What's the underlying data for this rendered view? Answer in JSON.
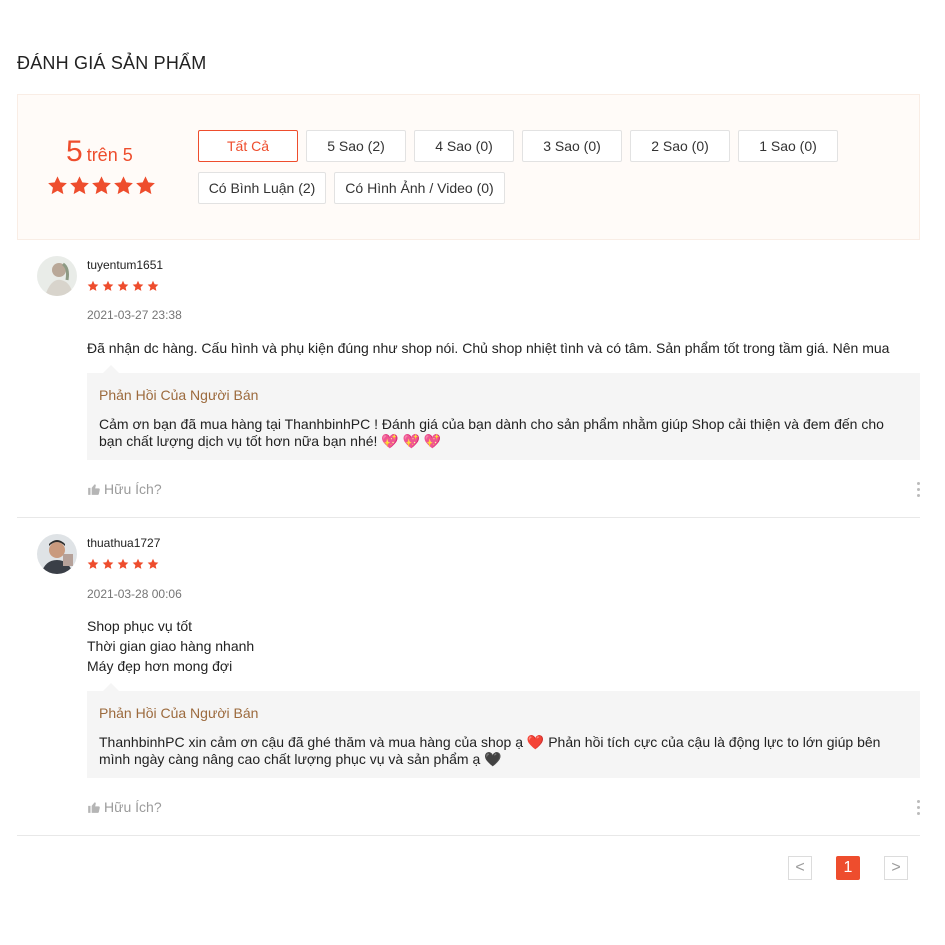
{
  "section_title": "ĐÁNH GIÁ SẢN PHẨM",
  "colors": {
    "accent": "#ee4d2d",
    "reply_title": "#9c6a3d",
    "overview_bg": "#fffbf8"
  },
  "overview": {
    "score": "5",
    "score_suffix": "trên 5",
    "rating_stars": 5,
    "filters_row1": [
      "Tất Cả",
      "5 Sao (2)",
      "4 Sao (0)",
      "3 Sao (0)",
      "2 Sao (0)",
      "1 Sao (0)"
    ],
    "filters_row2": [
      "Có Bình Luận (2)",
      "Có Hình Ảnh / Video (0)"
    ],
    "active_filter": "Tất Cả"
  },
  "reviews": [
    {
      "username": "tuyentum1651",
      "stars": 5,
      "time": "2021-03-27 23:38",
      "content": [
        "Đã nhận dc hàng. Cấu hình và phụ kiện đúng như shop nói. Chủ shop nhiệt tình và có tâm. Sản phẩm tốt trong tầm giá. Nên mua"
      ],
      "reply_title": "Phản Hồi Của Người Bán",
      "reply_text": "Cảm ơn bạn đã mua hàng tại ThanhbinhPC ! Đánh giá của bạn dành cho sản phẩm nhằm giúp Shop cải thiện và đem đến cho bạn chất lượng dịch vụ tốt hơn nữa bạn nhé! 💖 💖 💖",
      "helpful": "Hữu Ích?"
    },
    {
      "username": "thuathua1727",
      "stars": 5,
      "time": "2021-03-28 00:06",
      "content": [
        "Shop phục vụ tốt",
        "Thời gian giao hàng nhanh",
        "Máy đẹp hơn mong đợi"
      ],
      "reply_title": "Phản Hồi Của Người Bán",
      "reply_text": "ThanhbinhPC xin cảm ơn cậu đã ghé thăm và mua hàng của shop ạ ❤️  Phản hồi tích cực của cậu là động lực to lớn giúp bên mình ngày càng nâng cao chất lượng phục vụ và sản phẩm ạ 🖤",
      "helpful": "Hữu Ích?"
    }
  ],
  "pagination": {
    "prev": "<",
    "current": "1",
    "next": ">"
  }
}
